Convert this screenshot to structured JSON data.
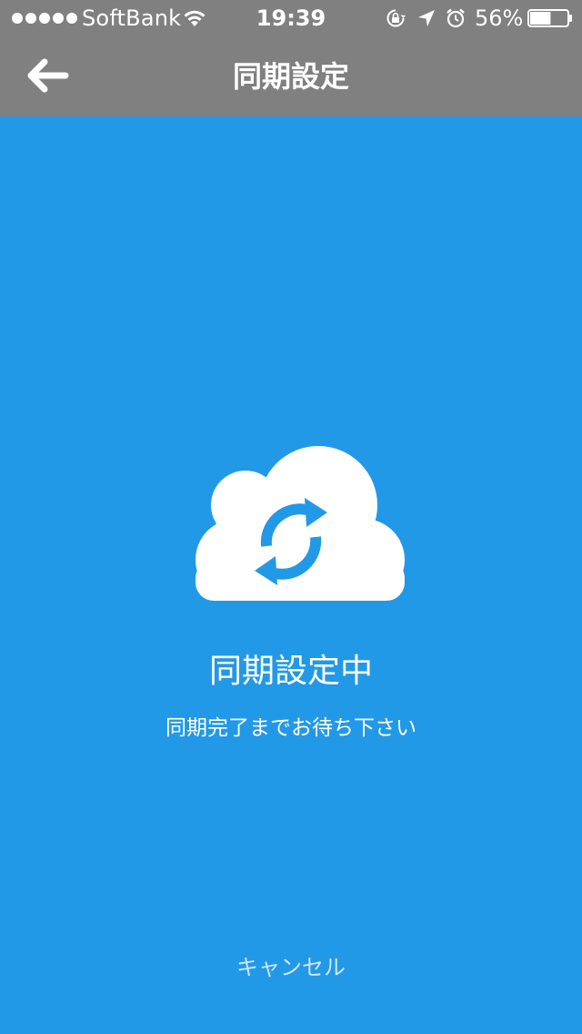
{
  "status_bar": {
    "carrier": "SoftBank",
    "time": "19:39",
    "battery_percent": "56%",
    "battery_level": 0.56,
    "signal_bars": 5,
    "icons": [
      "signal-dots",
      "wifi-icon",
      "lock-rotation-icon",
      "location-icon",
      "alarm-icon",
      "battery-icon"
    ]
  },
  "nav": {
    "title": "同期設定",
    "back_icon": "back-arrow-icon"
  },
  "main": {
    "illustration_icon": "cloud-sync-icon",
    "title": "同期設定中",
    "subtitle": "同期完了までお待ち下さい",
    "cancel_label": "キャンセル"
  },
  "colors": {
    "background": "#2299e6",
    "header": "#808080",
    "text": "#ffffff",
    "cancel_text": "#cfe6f7"
  }
}
